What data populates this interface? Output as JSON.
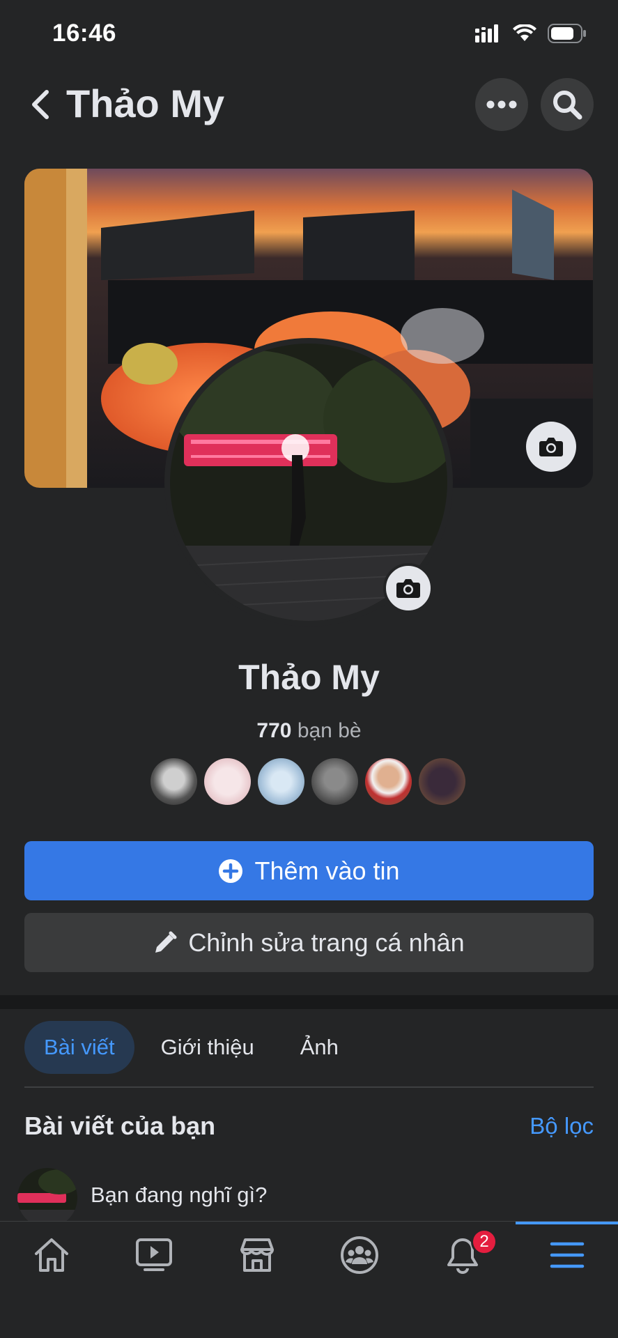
{
  "status_bar": {
    "time": "16:46"
  },
  "header": {
    "title": "Thảo My"
  },
  "profile": {
    "name": "Thảo My",
    "friends_count": "770",
    "friends_label": "bạn bè"
  },
  "actions": {
    "add_story": "Thêm vào tin",
    "edit_profile": "Chỉnh sửa trang cá nhân"
  },
  "tabs": [
    {
      "label": "Bài viết",
      "active": true
    },
    {
      "label": "Giới thiệu",
      "active": false
    },
    {
      "label": "Ảnh",
      "active": false
    }
  ],
  "posts_section": {
    "title": "Bài viết của bạn",
    "filter": "Bộ lọc"
  },
  "composer": {
    "placeholder": "Bạn đang nghĩ gì?"
  },
  "bottom_nav": {
    "items": [
      "home-icon",
      "watch-icon",
      "marketplace-icon",
      "groups-icon",
      "notifications-icon",
      "menu-icon"
    ],
    "notification_badge": "2",
    "active": "menu-icon"
  },
  "colors": {
    "background": "#242526",
    "accent": "#3578e5",
    "link": "#4599ff",
    "badge": "#e41e3f"
  }
}
